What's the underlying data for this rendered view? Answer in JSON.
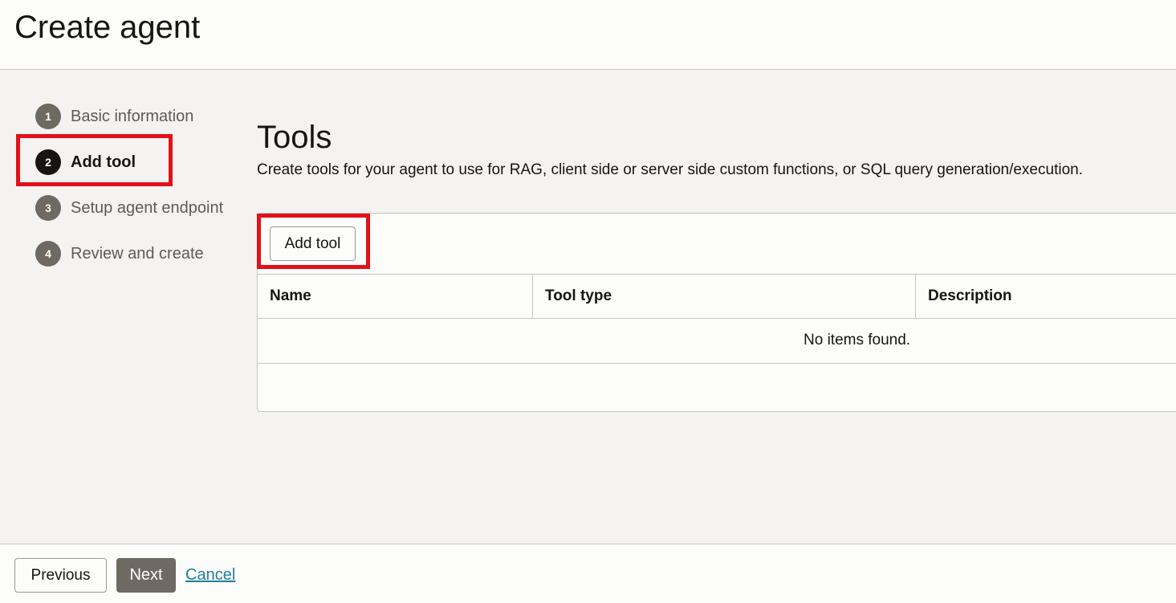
{
  "header": {
    "title": "Create agent"
  },
  "steps": [
    {
      "number": "1",
      "label": "Basic information"
    },
    {
      "number": "2",
      "label": "Add tool"
    },
    {
      "number": "3",
      "label": "Setup agent endpoint"
    },
    {
      "number": "4",
      "label": "Review and create"
    }
  ],
  "content": {
    "title": "Tools",
    "description": "Create tools for your agent to use for RAG, client side or server side custom functions, or SQL query generation/execution.",
    "add_tool_label": "Add tool",
    "table": {
      "columns": [
        "Name",
        "Tool type",
        "Description"
      ],
      "empty_message": "No items found."
    }
  },
  "footer": {
    "previous_label": "Previous",
    "next_label": "Next",
    "cancel_label": "Cancel"
  },
  "colors": {
    "highlight": "#e3111a",
    "active_step": "#161513",
    "inactive_step": "#6f6964",
    "link": "#227e9e"
  }
}
